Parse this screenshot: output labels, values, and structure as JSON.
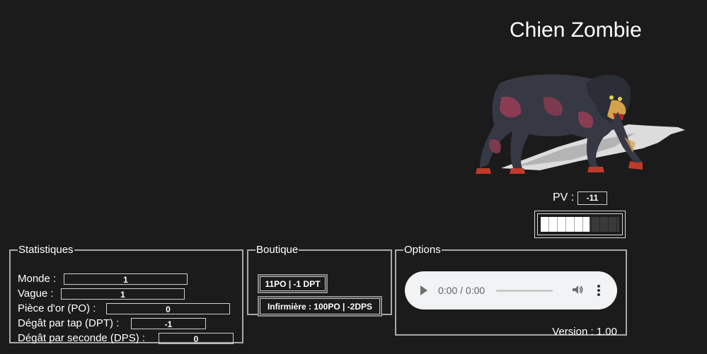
{
  "monster": {
    "name": "Chien Zombie",
    "image_icon": "zombie-dog-icon",
    "pv_label": "PV :",
    "pv_value": "-11",
    "hp_fill_fraction": 0.62
  },
  "stats": {
    "legend": "Statistiques",
    "rows": [
      {
        "label": "Monde :",
        "value": "1"
      },
      {
        "label": "Vague :",
        "value": "1"
      },
      {
        "label": "Pièce d'or (PO) :",
        "value": "0"
      },
      {
        "label": "Dégât par tap (DPT) :",
        "value": "-1"
      },
      {
        "label": "Dégât par seconde (DPS) :",
        "value": "0"
      }
    ]
  },
  "shop": {
    "legend": "Boutique",
    "items": [
      {
        "label": "11PO | -1 DPT"
      },
      {
        "label": "Infirmière : 100PO | -2DPS"
      }
    ]
  },
  "options": {
    "legend": "Options",
    "audio": {
      "time": "0:00 / 0:00",
      "play_icon": "play-icon",
      "volume_icon": "volume-icon",
      "more_icon": "more-options-icon"
    },
    "version": "Version : 1.00"
  },
  "colors": {
    "background": "#1b1b1b",
    "text": "#ffffff",
    "border": "#a9a9a9"
  }
}
